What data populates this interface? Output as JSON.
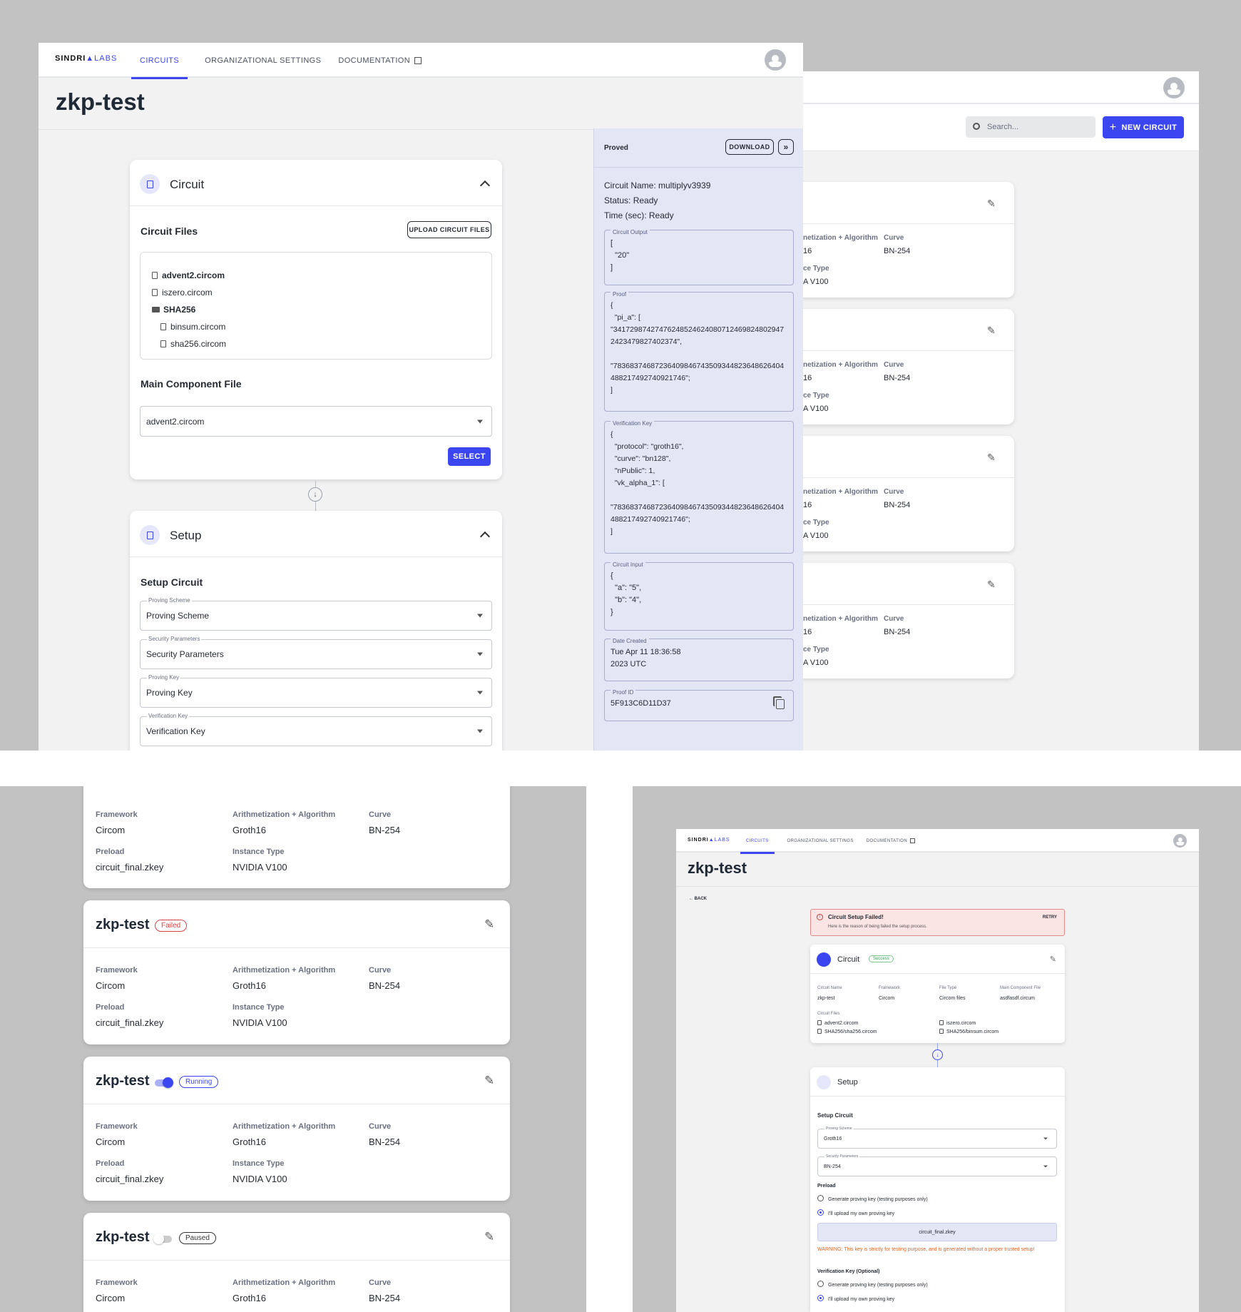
{
  "brand": {
    "name": "SINDRI",
    "suffix": "LABS",
    "accent": "#3c46f0"
  },
  "nav": {
    "tabs": [
      "CIRCUITS",
      "ORGANIZATIONAL SETTINGS",
      "DOCUMENTATION"
    ]
  },
  "page_title": "zkp-test",
  "circuit_section": {
    "title": "Circuit",
    "files_heading": "Circuit Files",
    "upload_label": "UPLOAD CIRCUIT FILES",
    "files": [
      {
        "name": "advent2.circom",
        "type": "file",
        "bold": true
      },
      {
        "name": "iszero.circom",
        "type": "file"
      },
      {
        "name": "SHA256",
        "type": "folder"
      },
      {
        "name": "binsum.circom",
        "type": "file",
        "nested": true
      },
      {
        "name": "sha256.circom",
        "type": "file",
        "nested": true
      }
    ],
    "main_component_heading": "Main Component File",
    "main_component_value": "advent2.circom",
    "select_label": "SELECT"
  },
  "setup_section": {
    "title": "Setup",
    "heading": "Setup Circuit",
    "fields": [
      {
        "label": "Proving Scheme",
        "value": "Proving Scheme"
      },
      {
        "label": "Security Parameters",
        "value": "Security Parameters"
      },
      {
        "label": "Proving Key",
        "value": "Proving Key"
      },
      {
        "label": "Verification Key",
        "value": "Verification Key"
      }
    ]
  },
  "proof_panel": {
    "status": "Proved",
    "download_label": "DOWNLOAD",
    "lines": [
      "Circuit Name: multiplyv3939",
      "Status: Ready",
      "Time (sec): Ready"
    ],
    "circuit_output": {
      "legend": "Circuit Output",
      "lines": [
        "[",
        "  \"20\"",
        "]"
      ]
    },
    "proof": {
      "legend": "Proof",
      "lines": [
        "{",
        "  \"pi_a\": [",
        "\"34172987427476248524624080712469824802947",
        "2423479827402374\",",
        "",
        "\"78368374687236409846743509344823648626404",
        "488217492740921746\";",
        "]"
      ]
    },
    "verification_key": {
      "legend": "Verification Key",
      "lines": [
        "{",
        "  \"protocol\": \"groth16\",",
        "  \"curve\": \"bn128\",",
        "  \"nPublic\": 1,",
        "  \"vk_alpha_1\": [",
        "",
        "\"78368374687236409846743509344823648626404",
        "488217492740921746\";",
        "]"
      ]
    },
    "circuit_input": {
      "legend": "Circuit Input",
      "lines": [
        "{",
        "  \"a\": \"5\",",
        "  \"b\": \"4\",",
        "}"
      ]
    },
    "date_created": {
      "legend": "Date Created",
      "lines": [
        "Tue Apr 11 18:36:58",
        "2023 UTC"
      ]
    },
    "proof_id": {
      "legend": "Proof ID",
      "value": "5F913C6D11D37"
    }
  },
  "list_view": {
    "search_placeholder": "Search...",
    "new_circuit_label": "NEW CIRCUIT",
    "rows": [
      {
        "algo_label": "netization + Algorithm",
        "algo_value": "16",
        "curve_label": "Curve",
        "curve_value": "BN-254",
        "inst_label": "ce Type",
        "inst_value": "A V100"
      },
      {
        "algo_label": "netization + Algorithm",
        "algo_value": "16",
        "curve_label": "Curve",
        "curve_value": "BN-254",
        "inst_label": "ce Type",
        "inst_value": "A V100"
      },
      {
        "algo_label": "netization + Algorithm",
        "algo_value": "16",
        "curve_label": "Curve",
        "curve_value": "BN-254",
        "inst_label": "ce Type",
        "inst_value": "A V100"
      },
      {
        "algo_label": "netization + Algorithm",
        "algo_value": "16",
        "curve_label": "Curve",
        "curve_value": "BN-254",
        "inst_label": "ce Type",
        "inst_value": "A V100"
      }
    ]
  },
  "cards": {
    "labels": {
      "framework": "Framework",
      "algorithm": "Arithmetization + Algorithm",
      "curve": "Curve",
      "preload": "Preload",
      "instance": "Instance Type"
    },
    "values": {
      "framework": "Circom",
      "algorithm": "Groth16",
      "curve": "BN-254",
      "preload": "circuit_final.zkey",
      "instance": "NVIDIA V100"
    },
    "items": [
      {
        "title": "zkp-test",
        "status": "Failed",
        "status_color": "#d64545"
      },
      {
        "title": "zkp-test",
        "status": "Running",
        "status_color": "#3c46f0"
      },
      {
        "title": "zkp-test",
        "status": "Paused",
        "status_color": "#333333"
      }
    ]
  },
  "detail_view": {
    "back_label": "BACK",
    "alert_title": "Circuit Setup Failed!",
    "alert_body": "Here is the reason of being failed the setup process.",
    "retry_label": "RETRY",
    "circuit_title": "Circuit",
    "circuit_status": "Success",
    "meta": [
      {
        "label": "Circuit Name",
        "value": "zkp-test"
      },
      {
        "label": "Framework",
        "value": "Circom"
      },
      {
        "label": "File Type",
        "value": "Circom files"
      },
      {
        "label": "Main Component File",
        "value": "asdfasdf.circum"
      }
    ],
    "files_label": "Circuit Files",
    "files": [
      "advent2.circom",
      "iszero.circom",
      "SHA256/sha256.circom",
      "SHA256/binsum.circom"
    ],
    "setup_title": "Setup",
    "setup_heading": "Setup Circuit",
    "proving_scheme": {
      "label": "Proving Scheme",
      "value": "Groth16"
    },
    "security": {
      "label": "Security Parameters",
      "value": "BN-254"
    },
    "preload_label": "Preload",
    "radio_generate": "Generate proving key (testing purposes only)",
    "radio_upload": "I'll upload my own proving key",
    "file_chip": "circuit_final.zkey",
    "warning": "WARNING: This key is strictly for testing purpose, and is generated without a proper trusted setup!",
    "vk_label": "Verification Key (Optional)",
    "vk_generate": "Generate proving key (testing purposes only)",
    "vk_upload": "I'll upload my own proving key"
  }
}
